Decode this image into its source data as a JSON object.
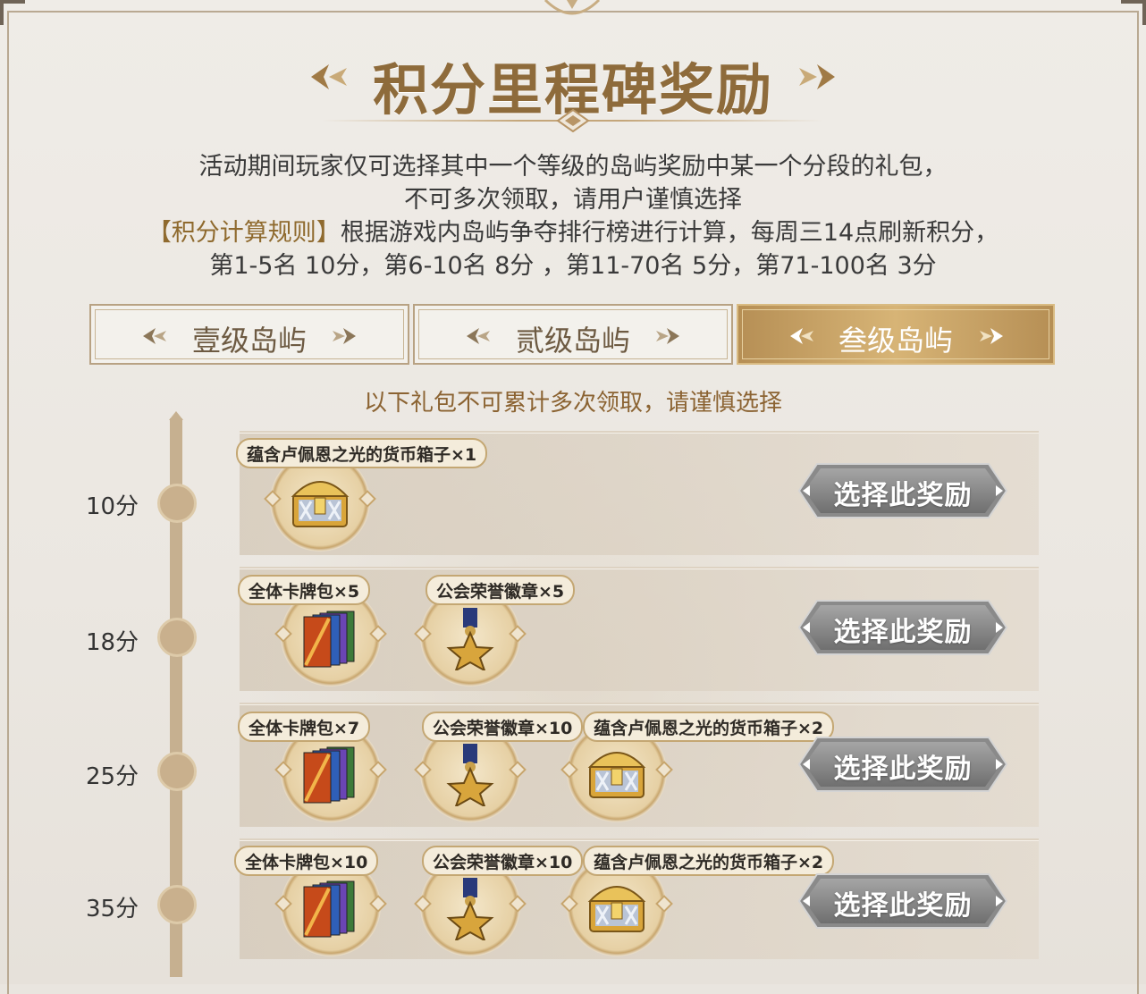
{
  "title": "积分里程碑奖励",
  "description": {
    "line1": "活动期间玩家仅可选择其中一个等级的岛屿奖励中某一个分段的礼包，",
    "line2": "不可多次领取，请用户谨慎选择",
    "rule_label": "【积分计算规则】",
    "rule_text": "根据游戏内岛屿争夺排行榜进行计算，每周三14点刷新积分，",
    "line4": "第1-5名 10分，第6-10名 8分 ，第11-70名 5分，第71-100名 3分"
  },
  "tabs": [
    {
      "label": "壹级岛屿",
      "active": false
    },
    {
      "label": "贰级岛屿",
      "active": false
    },
    {
      "label": "叁级岛屿",
      "active": true
    }
  ],
  "notice": "以下礼包不可累计多次领取，请谨慎选择",
  "select_label": "选择此奖励",
  "tiers": [
    {
      "points": "10分",
      "items": [
        {
          "name": "蕴含卢佩恩之光的货币箱子×1",
          "icon": "chest-icon"
        }
      ]
    },
    {
      "points": "18分",
      "items": [
        {
          "name": "全体卡牌包×5",
          "icon": "card-pack-icon"
        },
        {
          "name": "公会荣誉徽章×5",
          "icon": "medal-icon"
        }
      ]
    },
    {
      "points": "25分",
      "items": [
        {
          "name": "全体卡牌包×7",
          "icon": "card-pack-icon"
        },
        {
          "name": "公会荣誉徽章×10",
          "icon": "medal-icon"
        },
        {
          "name": "蕴含卢佩恩之光的货币箱子×2",
          "icon": "chest-icon"
        }
      ]
    },
    {
      "points": "35分",
      "items": [
        {
          "name": "全体卡牌包×10",
          "icon": "card-pack-icon"
        },
        {
          "name": "公会荣誉徽章×10",
          "icon": "medal-icon"
        },
        {
          "name": "蕴含卢佩恩之光的货币箱子×2",
          "icon": "chest-icon"
        }
      ]
    }
  ],
  "colors": {
    "gold": "#8e6b3b",
    "active_tab": "#c9a466",
    "button": "#8f8f8f"
  }
}
